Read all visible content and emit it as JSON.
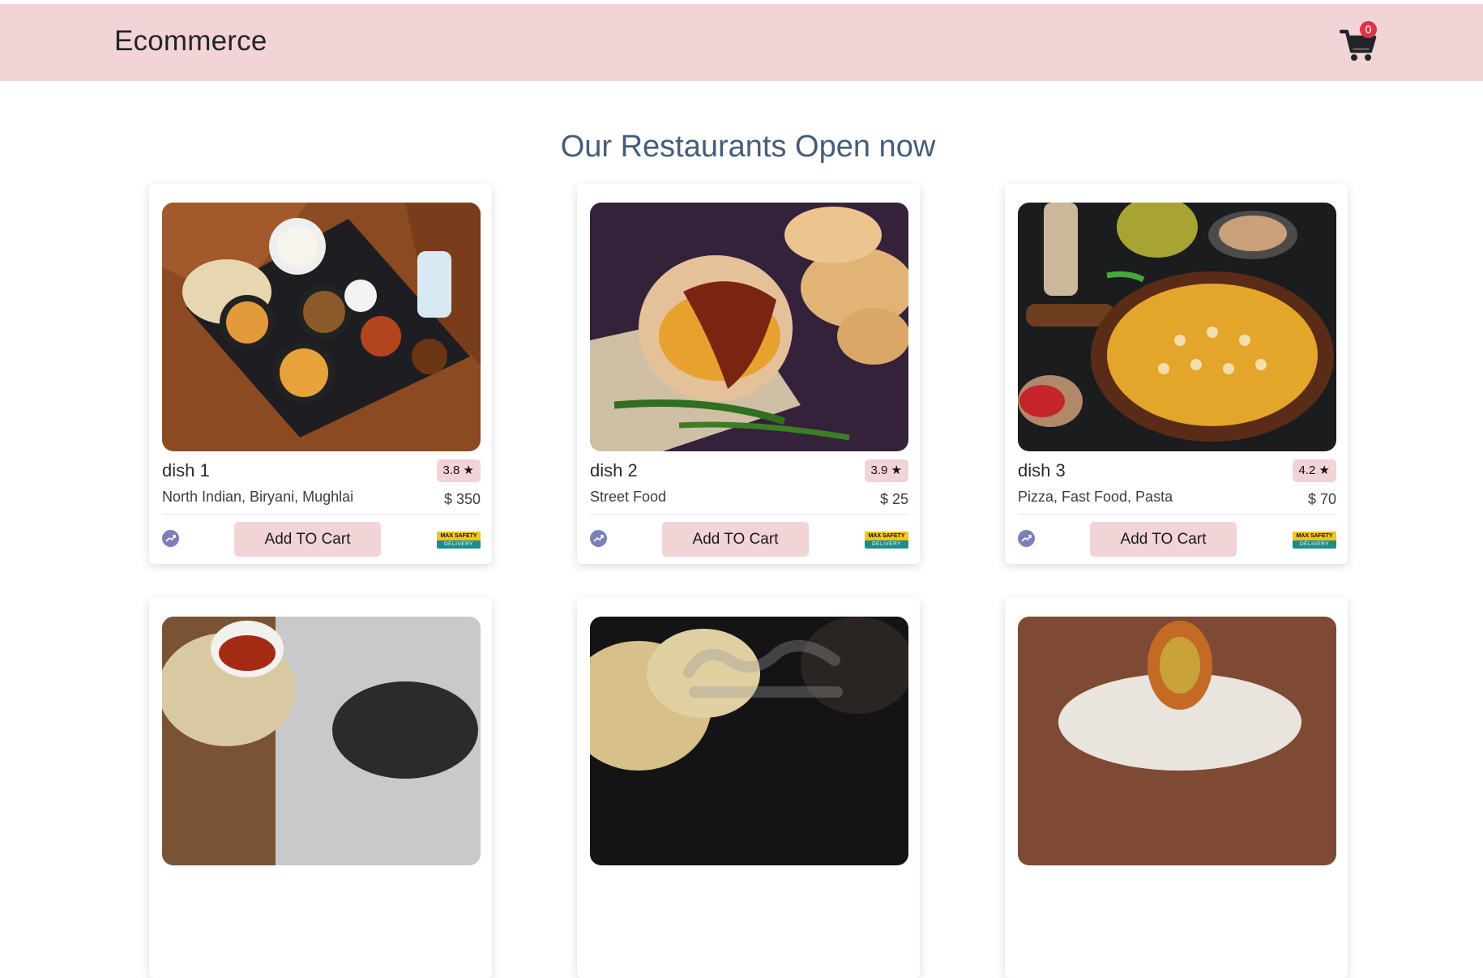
{
  "header": {
    "brand": "Ecommerce",
    "cart_count": "0"
  },
  "section_title": "Our Restaurants Open now",
  "cards": [
    {
      "title": "dish 1",
      "rating": "3.8 ★",
      "cuisine": "North Indian, Biryani, Mughlai",
      "price": "$ 350",
      "button": "Add TO Cart",
      "badge_top": "MAX SAFETY",
      "badge_bottom": "DELIVERY"
    },
    {
      "title": "dish 2",
      "rating": "3.9 ★",
      "cuisine": "Street Food",
      "price": "$ 25",
      "button": "Add TO Cart",
      "badge_top": "MAX SAFETY",
      "badge_bottom": "DELIVERY"
    },
    {
      "title": "dish 3",
      "rating": "4.2 ★",
      "cuisine": "Pizza, Fast Food, Pasta",
      "price": "$ 70",
      "button": "Add TO Cart",
      "badge_top": "MAX SAFETY",
      "badge_bottom": "DELIVERY"
    }
  ],
  "icons": {
    "cart": "shopping-cart-icon",
    "trend": "trending-up-icon"
  },
  "colors": {
    "navbar_bg": "#f2d4d7",
    "heading": "#465d79",
    "badge": "#dc3545",
    "trend": "#7c80ba"
  }
}
